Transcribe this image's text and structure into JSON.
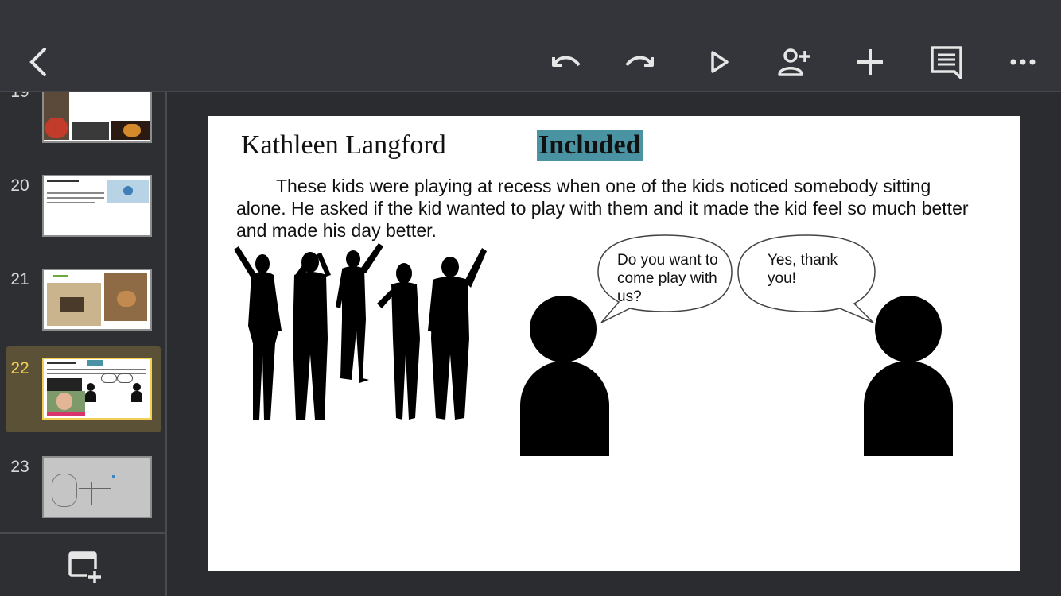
{
  "toolbar": {
    "back_icon": "chevron-left-icon",
    "undo_icon": "undo-icon",
    "redo_icon": "redo-icon",
    "present_icon": "play-icon",
    "share_icon": "add-person-icon",
    "insert_icon": "plus-icon",
    "comment_icon": "comment-icon",
    "more_icon": "more-horizontal-icon"
  },
  "sidebar": {
    "slides": [
      {
        "number": "19"
      },
      {
        "number": "20"
      },
      {
        "number": "21"
      },
      {
        "number": "22",
        "selected": true
      },
      {
        "number": "23"
      }
    ],
    "add_slide_icon": "new-slide-icon"
  },
  "slide": {
    "author": "Kathleen Langford",
    "title": "Included",
    "body": "These kids were playing at recess when one of the kids noticed somebody sitting alone. He asked if the kid wanted to play with them and it made the kid feel so much better and made his day better.",
    "bubble_left": "Do you want to come play with us?",
    "bubble_right": "Yes, thank you!"
  },
  "colors": {
    "toolbar_bg": "#34353a",
    "selected_slide_bg": "#5a5136",
    "selected_accent": "#f2cf56",
    "title_highlight": "#4a93a2"
  }
}
